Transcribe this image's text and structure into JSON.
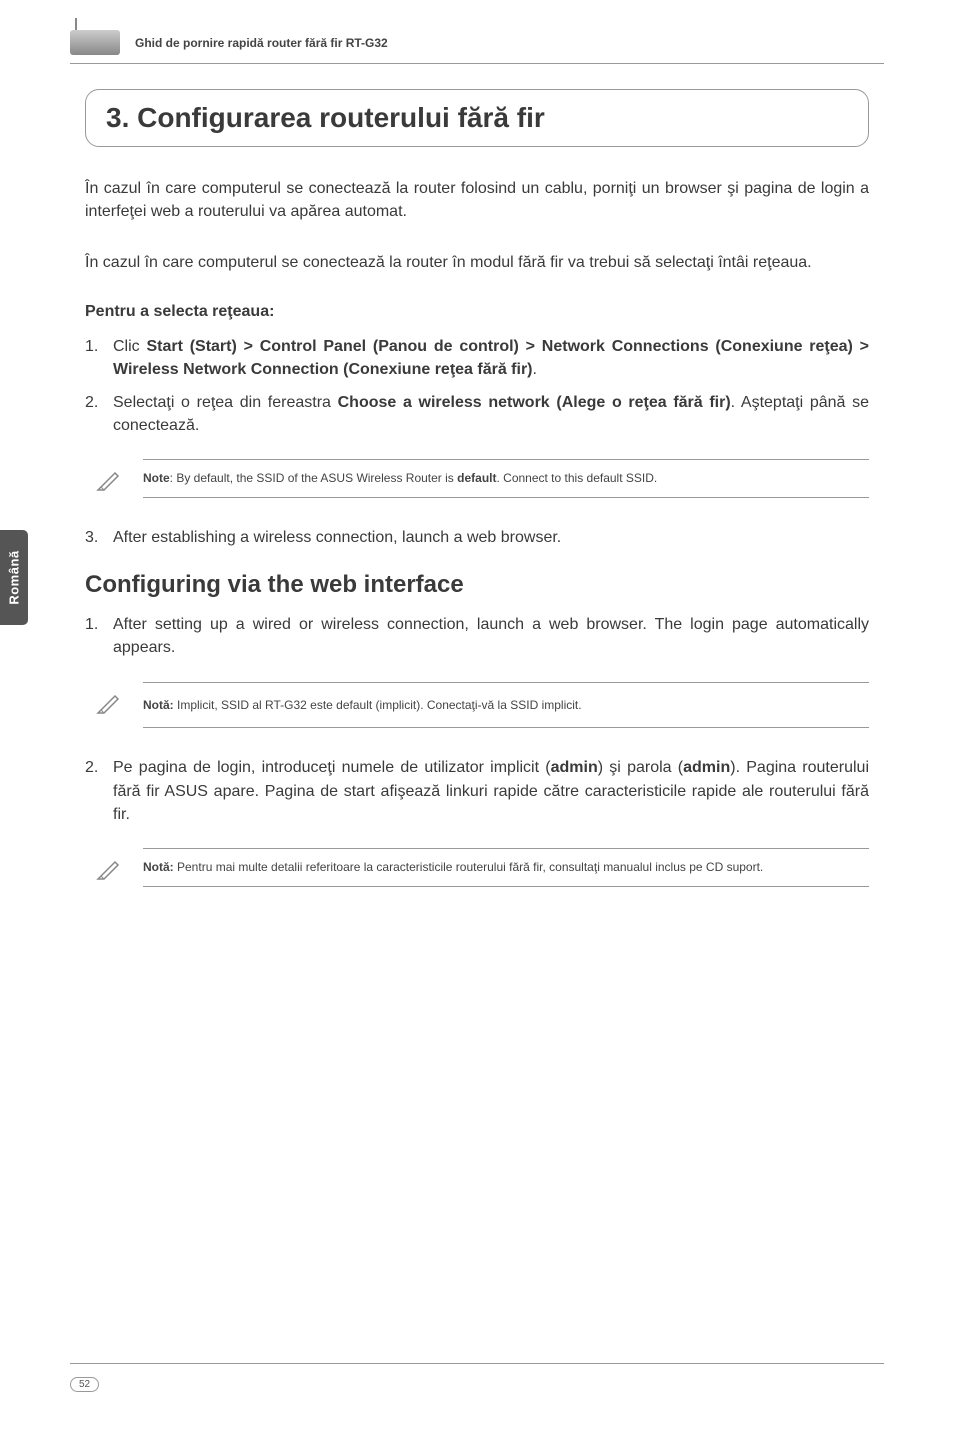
{
  "header": {
    "title": "Ghid de pornire rapidă router fără fir RT-G32"
  },
  "sideTab": "Română",
  "sectionTitle": "3. Configurarea routerului fără fir",
  "para1": "În cazul în care  computerul se conectează la router folosind un cablu, porniţi un browser şi pagina de login a interfeţei web a routerului va apărea automat.",
  "para2": "În cazul în care computerul se conectează la router în modul fără fir va trebui să selectaţi întâi reţeaua.",
  "subheading1": "Pentru a selecta reţeaua:",
  "list1": {
    "item1": {
      "num": "1.",
      "prefix": "Clic ",
      "bold": "Start (Start) > Control Panel (Panou de control) > Network Connections (Conexiune reţea) > Wireless Network Connection (Conexiune reţea fără fir)",
      "suffix": "."
    },
    "item2": {
      "num": "2.",
      "prefix": "Selectaţi o reţea din fereastra ",
      "bold": "Choose a wireless network (Alege o reţea fără fir)",
      "suffix": ". Aşteptaţi până se conectează."
    }
  },
  "note1": {
    "label": "Note",
    "text": ":  By default, the SSID of the ASUS Wireless Router is ",
    "bold": "default",
    "suffix": ". Connect to this default SSID."
  },
  "list2": {
    "item3": {
      "num": "3.",
      "text": "After establishing a wireless connection, launch a web browser."
    }
  },
  "h2Title": "Configuring via the web interface",
  "list3": {
    "item1": {
      "num": "1.",
      "text": "After setting up a wired or wireless connection, launch a web browser. The login page automatically appears."
    }
  },
  "note2": {
    "label": "Notă:",
    "text": " Implicit, SSID al RT-G32 este default (implicit). Conectaţi-vă la SSID implicit."
  },
  "list4": {
    "item2": {
      "num": "2.",
      "prefix": "Pe pagina de login, introduceţi numele de utilizator implicit (",
      "bold1": "admin",
      "mid": ") şi parola (",
      "bold2": "admin",
      "suffix": "). Pagina routerului fără fir ASUS apare. Pagina de start afişează linkuri rapide către caracteristicile rapide ale routerului fără fir."
    }
  },
  "note3": {
    "label": "Notă:",
    "text": " Pentru mai multe detalii referitoare la caracteristicile routerului fără fir, consultaţi manualul inclus pe CD suport."
  },
  "pageNumber": "52"
}
